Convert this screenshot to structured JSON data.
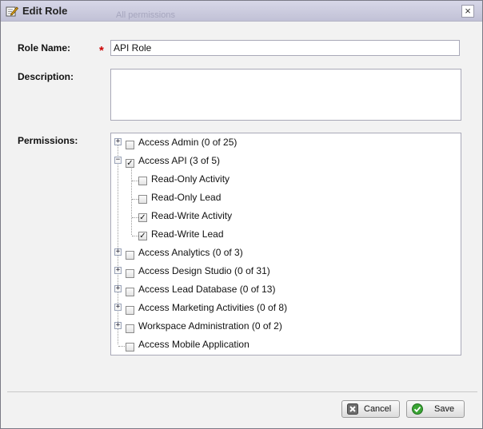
{
  "dialog": {
    "title": "Edit Role",
    "ghost_text": "All permissions",
    "close_symbol": "×"
  },
  "form": {
    "role_name_label": "Role Name:",
    "required_marker": "*",
    "role_name_value": "API Role",
    "description_label": "Description:",
    "description_value": "",
    "permissions_label": "Permissions:"
  },
  "permissions": [
    {
      "label": "Access Admin (0 of 25)",
      "checked": false,
      "expander": "+"
    },
    {
      "label": "Access API (3 of 5)",
      "checked": true,
      "expander": "−"
    },
    {
      "label": "Read-Only Activity",
      "checked": false
    },
    {
      "label": "Read-Only Lead",
      "checked": false
    },
    {
      "label": "Read-Write Activity",
      "checked": true
    },
    {
      "label": "Read-Write Lead",
      "checked": true
    },
    {
      "label": "Access Analytics (0 of 3)",
      "checked": false,
      "expander": "+"
    },
    {
      "label": "Access Design Studio (0 of 31)",
      "checked": false,
      "expander": "+"
    },
    {
      "label": "Access Lead Database (0 of 13)",
      "checked": false,
      "expander": "+"
    },
    {
      "label": "Access Marketing Activities (0 of 8)",
      "checked": false,
      "expander": "+"
    },
    {
      "label": "Workspace Administration (0 of 2)",
      "checked": false,
      "expander": "+"
    },
    {
      "label": "Access Mobile Application",
      "checked": false
    }
  ],
  "check_symbol": "✓",
  "footer": {
    "cancel_label": "Cancel",
    "save_label": "Save"
  },
  "icons": {
    "title": "edit-pencil-icon",
    "cancel": "cancel-x-icon",
    "save": "save-check-icon"
  },
  "colors": {
    "titlebar": "#c8c8dc",
    "required": "#cc0000",
    "save_icon": "#3aa534",
    "cancel_icon": "#666666"
  }
}
